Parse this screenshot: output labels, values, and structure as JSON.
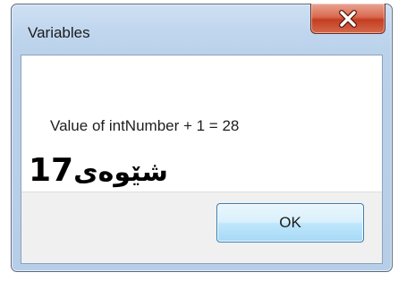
{
  "window": {
    "title": "Variables"
  },
  "dialog": {
    "message": "Value of intNumber + 1 = 28",
    "ok_label": "OK"
  },
  "icons": {
    "close": "close-icon"
  },
  "watermark": {
    "number": "17",
    "word": "شێوەی"
  },
  "colors": {
    "close_button": "#c43d22",
    "ok_button_border": "#3c7fb1",
    "frame": "#b9d1ea",
    "footer": "#f0f0f0"
  }
}
